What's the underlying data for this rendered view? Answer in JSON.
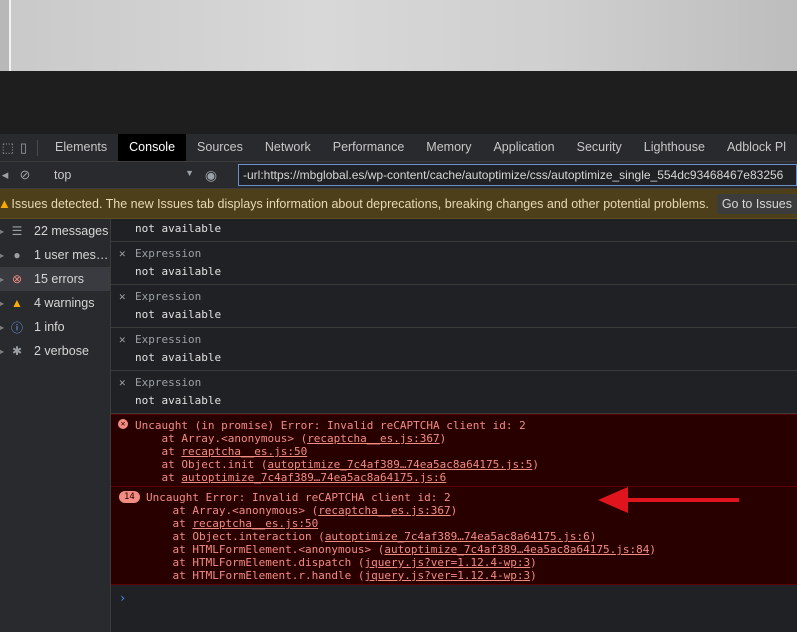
{
  "tabs": [
    "Elements",
    "Console",
    "Sources",
    "Network",
    "Performance",
    "Memory",
    "Application",
    "Security",
    "Lighthouse",
    "Adblock Pl"
  ],
  "active_tab": "Console",
  "toolbar": {
    "context": "top",
    "filter_value": "-url:https://mbglobal.es/wp-content/cache/autoptimize/css/autoptimize_single_554dc93468467e83256"
  },
  "issues_bar": {
    "text": "Issues detected. The new Issues tab displays information about deprecations, breaking changes and other potential problems.",
    "button": "Go to Issues"
  },
  "sidebar": [
    {
      "label": "22 messages",
      "icon": "list-icon"
    },
    {
      "label": "1 user mes…",
      "icon": "user-icon"
    },
    {
      "label": "15 errors",
      "icon": "error-icon"
    },
    {
      "label": "4 warnings",
      "icon": "warning-icon"
    },
    {
      "label": "1 info",
      "icon": "info-icon"
    },
    {
      "label": "2 verbose",
      "icon": "bug-icon"
    }
  ],
  "expressions": {
    "first_value": "not available",
    "items": [
      {
        "label": "Expression",
        "value": "not available"
      },
      {
        "label": "Expression",
        "value": "not available"
      },
      {
        "label": "Expression",
        "value": "not available"
      },
      {
        "label": "Expression",
        "value": "not available"
      }
    ]
  },
  "error1": {
    "title": "Uncaught (in promise) Error: Invalid reCAPTCHA client id: 2",
    "l1a": "    at Array.<anonymous> (",
    "l1b": "recaptcha__es.js:367",
    "l1c": ")",
    "l2a": "    at ",
    "l2b": "recaptcha__es.js:50",
    "l3a": "    at Object.init (",
    "l3b": "autoptimize_7c4af389…74ea5ac8a64175.js:5",
    "l3c": ")",
    "l4a": "    at ",
    "l4b": "autoptimize_7c4af389…74ea5ac8a64175.js:6"
  },
  "error2": {
    "count": "14",
    "title": "Uncaught Error: Invalid reCAPTCHA client id: 2",
    "l1a": "    at Array.<anonymous> (",
    "l1b": "recaptcha__es.js:367",
    "l1c": ")",
    "l2a": "    at ",
    "l2b": "recaptcha__es.js:50",
    "l3a": "    at Object.interaction (",
    "l3b": "autoptimize_7c4af389…74ea5ac8a64175.js:6",
    "l3c": ")",
    "l4a": "    at HTMLFormElement.<anonymous> (",
    "l4b": "autoptimize_7c4af389…4ea5ac8a64175.js:84",
    "l4c": ")",
    "l5a": "    at HTMLFormElement.dispatch (",
    "l5b": "jquery.js?ver=1.12.4-wp:3",
    "l5c": ")",
    "l6a": "    at HTMLFormElement.r.handle (",
    "l6b": "jquery.js?ver=1.12.4-wp:3",
    "l6c": ")"
  },
  "prompt_symbol": "›",
  "colors": {
    "error_bg": "#290000",
    "error_text": "#f28b82",
    "arrow": "#e0141c",
    "issues_bg": "#4c3f1a"
  }
}
